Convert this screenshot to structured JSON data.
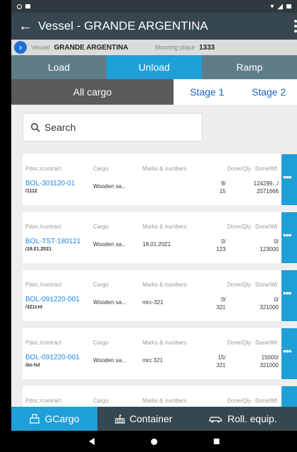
{
  "app": {
    "title": "Vessel - GRANDE ARGENTINA"
  },
  "info": {
    "vessel_label": "Vessel",
    "vessel_value": "GRANDE ARGENTINA",
    "mooring_label": "Mooring place",
    "mooring_value": "1333"
  },
  "main_tabs": [
    {
      "label": "Load"
    },
    {
      "label": "Unload"
    },
    {
      "label": "Ramp"
    }
  ],
  "stage_tabs": [
    {
      "label": "All cargo"
    },
    {
      "label": "Stage 1"
    },
    {
      "label": "Stage 2"
    }
  ],
  "search": {
    "placeholder": "Search"
  },
  "columns": {
    "doc": "Pdoc./contract",
    "cargo": "Cargo",
    "marks": "Marks & numbers",
    "done_qty": "Done/Qty",
    "done_wt": "Done/Wt"
  },
  "rows": [
    {
      "ref": "BOL-301120-01",
      "sub": "/1112",
      "cargo": "Wooden sa...",
      "marks": "",
      "qty_top": "9/",
      "qty_bot": "15",
      "wt_top": "124299.../",
      "wt_bot": "2071666"
    },
    {
      "ref": "BOL-TST-180121",
      "sub": "/18.01.2021",
      "cargo": "Wooden sa...",
      "marks": "18.01.2021",
      "qty_top": "0/",
      "qty_bot": "123",
      "wt_top": "0/",
      "wt_bot": "123000"
    },
    {
      "ref": "BOL-091220-001",
      "sub": "/321cnt",
      "cargo": "Wooden sa...",
      "marks": "mrc-321",
      "qty_top": "0/",
      "qty_bot": "321",
      "wt_top": "0/",
      "wt_bot": "321000"
    },
    {
      "ref": "BOL-091220-001",
      "sub": "/as-tst",
      "cargo": "Wooden sa...",
      "marks": "mrc 321",
      "qty_top": "15/",
      "qty_bot": "321",
      "wt_top": "15000/",
      "wt_bot": "321000"
    }
  ],
  "bottom_nav": [
    {
      "label": "GCargo",
      "icon": "crane-icon"
    },
    {
      "label": "Container",
      "icon": "container-icon"
    },
    {
      "label": "Roll. equip.",
      "icon": "car-icon"
    }
  ],
  "colors": {
    "accent": "#1e9fd8",
    "appbar": "#37474f",
    "link": "#1e88e5"
  }
}
